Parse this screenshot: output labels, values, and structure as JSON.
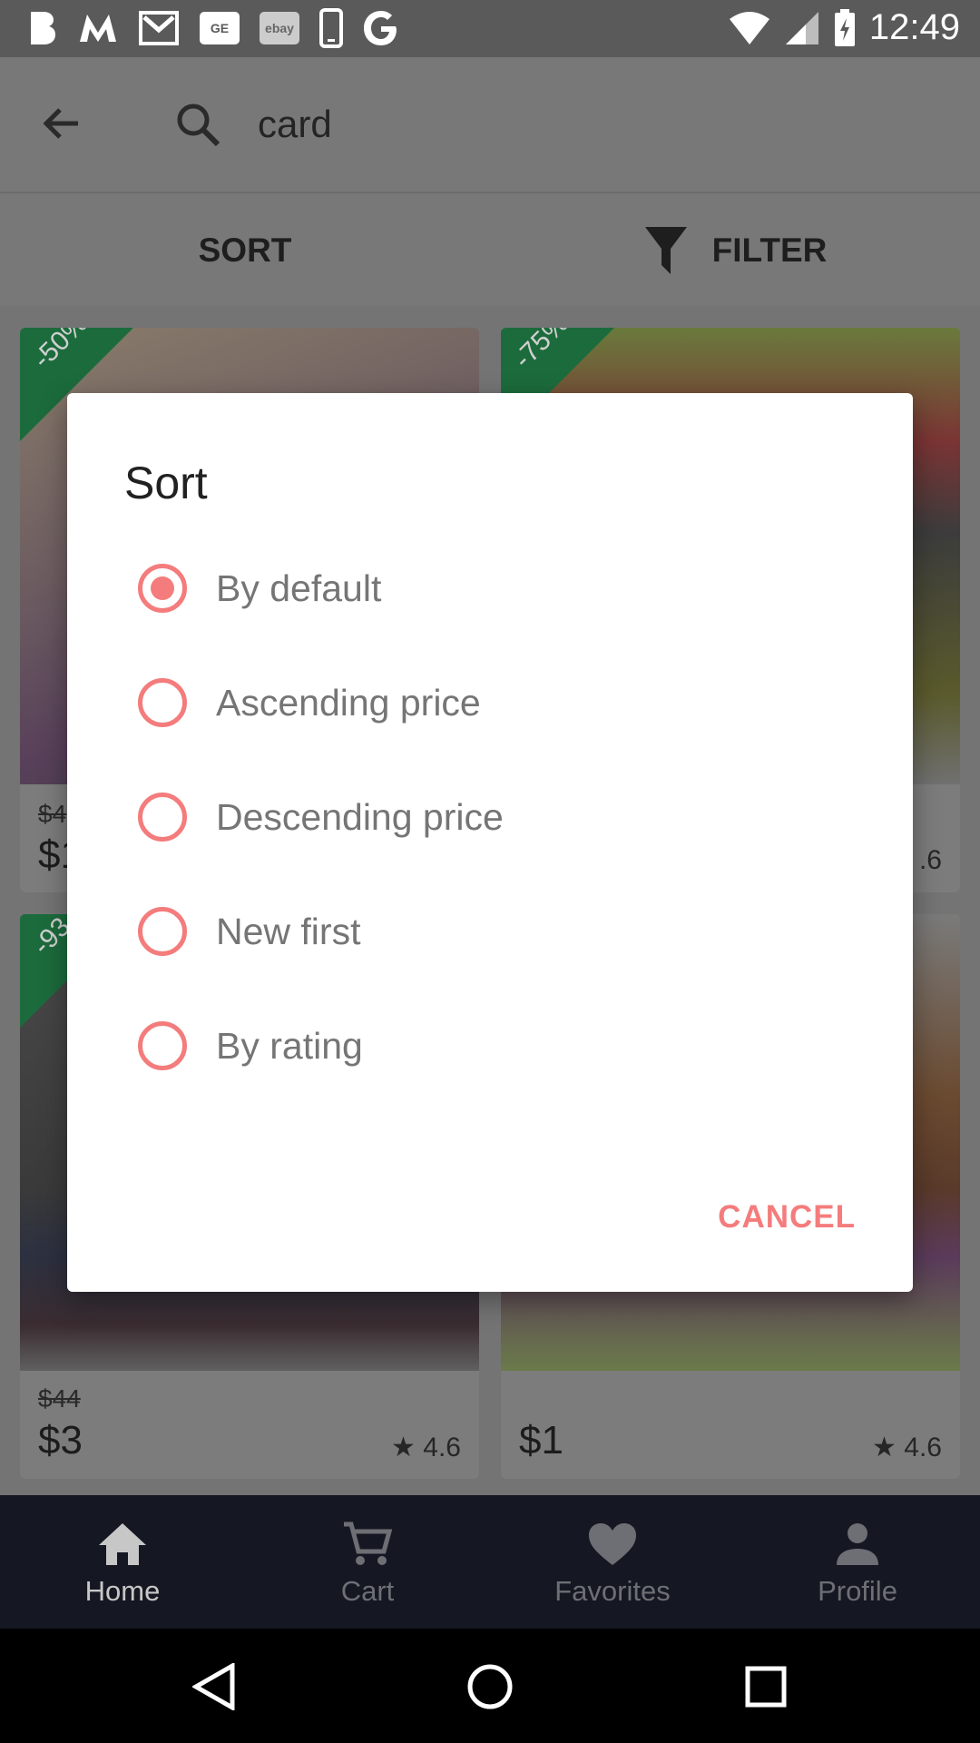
{
  "status_bar": {
    "left_icons": [
      "b-icon",
      "m-icon",
      "gmail-icon",
      "ge-icon",
      "ebay-icon",
      "phone-icon",
      "google-icon"
    ],
    "ebay_text": "ebay",
    "ge_text": "GE",
    "time": "12:49"
  },
  "search": {
    "query": "card"
  },
  "sort_bar": {
    "sort_label": "SORT",
    "filter_label": "FILTER"
  },
  "products": [
    {
      "badge": "-50%",
      "old_price": "$4",
      "price": "$1",
      "rating": ""
    },
    {
      "badge": "-75%",
      "old_price": "",
      "price": "",
      "rating": ".6"
    },
    {
      "badge": "-93",
      "old_price": "$44",
      "price": "$3",
      "rating": "4.6"
    },
    {
      "badge": "",
      "old_price": "",
      "price": "$1",
      "rating": "4.6"
    }
  ],
  "dialog": {
    "title": "Sort",
    "options": [
      {
        "label": "By default",
        "selected": true
      },
      {
        "label": "Ascending price",
        "selected": false
      },
      {
        "label": "Descending price",
        "selected": false
      },
      {
        "label": "New first",
        "selected": false
      },
      {
        "label": "By rating",
        "selected": false
      }
    ],
    "cancel_label": "CANCEL"
  },
  "bottom_nav": {
    "items": [
      {
        "label": "Home",
        "icon": "home-icon",
        "active": true
      },
      {
        "label": "Cart",
        "icon": "cart-icon",
        "active": false
      },
      {
        "label": "Favorites",
        "icon": "heart-icon",
        "active": false
      },
      {
        "label": "Profile",
        "icon": "person-icon",
        "active": false
      }
    ]
  },
  "colors": {
    "accent": "#f47c7c",
    "nav_bg": "#151822",
    "status_bg": "#5a5a5a"
  }
}
